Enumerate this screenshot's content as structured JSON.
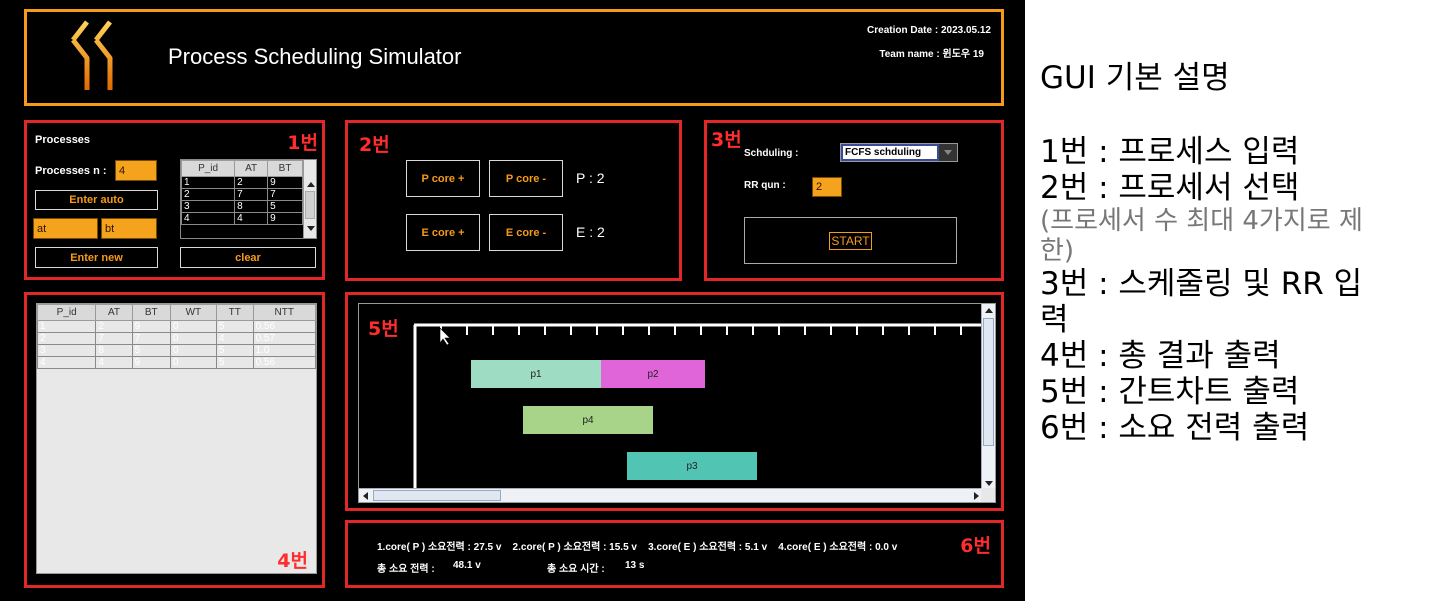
{
  "header": {
    "title": "Process Scheduling Simulator",
    "creation_date": "Creation Date : 2023.05.12",
    "team_name": "Team name : 윈도우 19"
  },
  "panel1": {
    "num": "1번",
    "title": "Processes",
    "n_label": "Processes n :",
    "n_value": "4",
    "enter_auto": "Enter auto",
    "at_value": "at",
    "bt_value": "bt",
    "enter_new": "Enter new",
    "clear": "clear",
    "table": {
      "headers": [
        "P_id",
        "AT",
        "BT"
      ],
      "rows": [
        [
          "1",
          "2",
          "9"
        ],
        [
          "2",
          "7",
          "7"
        ],
        [
          "3",
          "8",
          "5"
        ],
        [
          "4",
          "4",
          "9"
        ]
      ]
    }
  },
  "panel2": {
    "num": "2번",
    "p_add": "P core +",
    "p_remove": "P core -",
    "p_count": "P : 2",
    "e_add": "E core +",
    "e_remove": "E core -",
    "e_count": "E : 2"
  },
  "panel3": {
    "num": "3번",
    "sched_label": "Schduling :",
    "sched_value": "FCFS schduling",
    "rr_label": "RR qun :",
    "rr_value": "2",
    "start": "START"
  },
  "panel4": {
    "num": "4번",
    "table": {
      "headers": [
        "P_id",
        "AT",
        "BT",
        "WT",
        "TT",
        "NTT"
      ],
      "rows": [
        [
          "1",
          "2",
          "9",
          "0",
          "5",
          "0.56"
        ],
        [
          "2",
          "7",
          "7",
          "0",
          "4",
          "0.57"
        ],
        [
          "3",
          "8",
          "5",
          "0",
          "5",
          "1.0"
        ],
        [
          "4",
          "4",
          "9",
          "0",
          "5",
          "0.56"
        ]
      ]
    }
  },
  "panel5": {
    "num": "5번",
    "bars": [
      {
        "label": "p1",
        "color": "#9edcc4"
      },
      {
        "label": "p2",
        "color": "#e065d8"
      },
      {
        "label": "p4",
        "color": "#a8d48a"
      },
      {
        "label": "p3",
        "color": "#52c4b4"
      }
    ]
  },
  "panel6": {
    "num": "6번",
    "line1": "1.core( P ) 소요전력 : 27.5 v    2.core( P ) 소요전력 : 15.5 v    3.core( E ) 소요전력 : 5.1 v    4.core( E ) 소요전력 : 0.0 v",
    "total_power_label": "총 소요 전력 :",
    "total_power_value": "48.1 v",
    "total_time_label": "총 소요 시간 :",
    "total_time_value": "13 s"
  },
  "description": {
    "heading": "GUI 기본 설명",
    "item1": "1번 : 프로세스 입력",
    "item2": "2번 : 프로세서 선택",
    "note1": "(프로세서 수 최대 4가지로 제",
    "note2": "한)",
    "item3a": "3번 : 스케줄링 및 RR 입",
    "item3b": "력",
    "item4": "4번 : 총 결과 출력",
    "item5": "5번 : 간트차트 출력",
    "item6": "6번 : 소요 전력 출력"
  },
  "colors": {
    "accent": "#f59a1a",
    "section_border": "#e32626"
  }
}
